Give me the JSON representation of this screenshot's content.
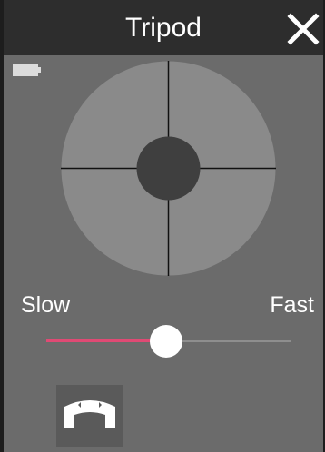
{
  "header": {
    "title": "Tripod"
  },
  "icons": {
    "close": "close-icon",
    "battery": "battery-icon",
    "mode": "tripod-mode-icon"
  },
  "speed": {
    "min_label": "Slow",
    "max_label": "Fast",
    "value_fraction": 0.49
  },
  "colors": {
    "accent": "#e04a74",
    "header_bg": "#2d2d2d",
    "panel_bg": "#6b6b6b",
    "pad": "#8a8a8a",
    "knob": "#3f3f3f"
  }
}
